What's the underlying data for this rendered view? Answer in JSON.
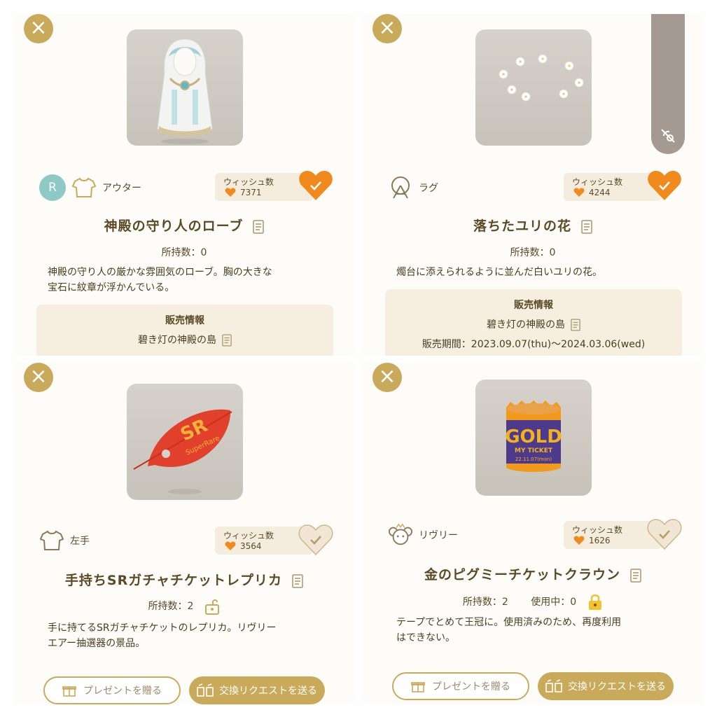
{
  "colors": {
    "accent": "#c9a95a",
    "heart_active": "#f08a1c",
    "heart_inactive": "#f1e6d3",
    "rarity": "#8ec9c6",
    "panel_bg": "#fdfcf9",
    "sale_bg": "#f6efe0"
  },
  "panels": [
    {
      "close_icon": "×",
      "rarity": "R",
      "category_icon": "shirt-icon",
      "category": "アウター",
      "wish_title": "ウィッシュ数",
      "wish_count": "7371",
      "wished": true,
      "title": "神殿の守り人のローブ",
      "owned": "所持数：0",
      "description": [
        "神殿の守り人の厳かな雰囲気のローブ。胸の大きな",
        "宝石に紋章が浮かんでいる。"
      ],
      "sale": {
        "title": "販売情報",
        "shop": "碧き灯の神殿の島"
      }
    },
    {
      "close_icon": "×",
      "category_icon": "rug-icon",
      "category": "ラグ",
      "wish_title": "ウィッシュ数",
      "wish_count": "4244",
      "wished": true,
      "title": "落ちたユリの花",
      "owned": "所持数：0",
      "description": [
        "燭台に添えられるように並んだ白いユリの花。"
      ],
      "sale": {
        "title": "販売情報",
        "shop": "碧き灯の神殿の島",
        "period": "販売期間：2023.09.07(thu)〜2024.03.06(wed)"
      }
    },
    {
      "close_icon": "×",
      "category_icon": "shirt-icon",
      "category": "左手",
      "wish_title": "ウィッシュ数",
      "wish_count": "3564",
      "wished": false,
      "title": "手持ちSRガチャチケットレプリカ",
      "owned": "所持数：2",
      "lock_state": "unlocked",
      "description": [
        "手に持てるSRガチャチケットのレプリカ。リヴリー",
        "エアー抽選器の景品。"
      ],
      "present_label": "プレゼントを贈る",
      "exchange_label": "交換リクエストを送る"
    },
    {
      "close_icon": "×",
      "category_icon": "livly-icon",
      "category": "リヴリー",
      "wish_title": "ウィッシュ数",
      "wish_count": "1626",
      "wished": false,
      "title": "金のピグミーチケットクラウン",
      "owned": "所持数：2",
      "in_use": "使用中：0",
      "lock_state": "locked",
      "description": [
        "テープでとめて王冠に。使用済みのため、再度利用",
        "はできない。"
      ],
      "present_label": "プレゼントを贈る",
      "exchange_label": "交換リクエストを送る"
    }
  ],
  "thumb_texts": {
    "leaf_big": "SR",
    "leaf_small": "SuperRare",
    "crown_big": "GOLD",
    "crown_mid": "MY TICKET",
    "crown_small": "22.11.07(mon)"
  }
}
